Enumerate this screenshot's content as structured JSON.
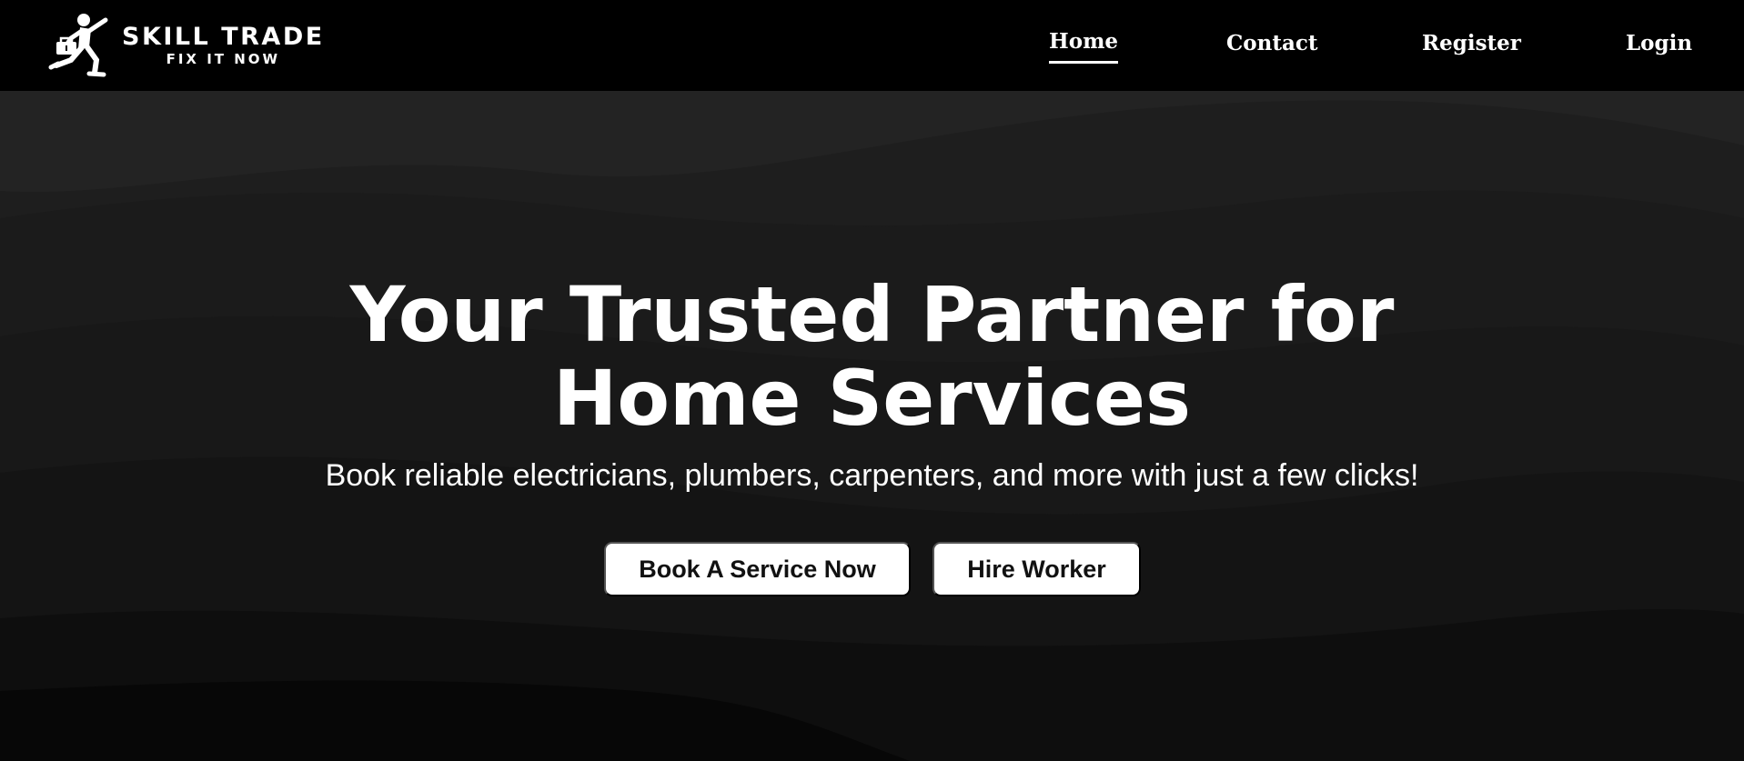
{
  "brand": {
    "name": "SKILL TRADE",
    "tagline": "FIX IT NOW",
    "logo_icon": "running-worker-with-toolbox-icon"
  },
  "nav": {
    "items": [
      {
        "label": "Home",
        "active": true
      },
      {
        "label": "Contact",
        "active": false
      },
      {
        "label": "Register",
        "active": false
      },
      {
        "label": "Login",
        "active": false
      }
    ]
  },
  "hero": {
    "title_line1": "Your Trusted Partner for",
    "title_line2": "Home Services",
    "subtitle": "Book reliable electricians, plumbers, carpenters, and more with just a few clicks!",
    "primary_button": "Book A Service Now",
    "secondary_button": "Hire Worker"
  },
  "colors": {
    "navbar_bg": "#000000",
    "hero_bg": "#1c1c1c",
    "button_bg": "#ffffff",
    "button_text": "#111111",
    "text": "#ffffff"
  }
}
